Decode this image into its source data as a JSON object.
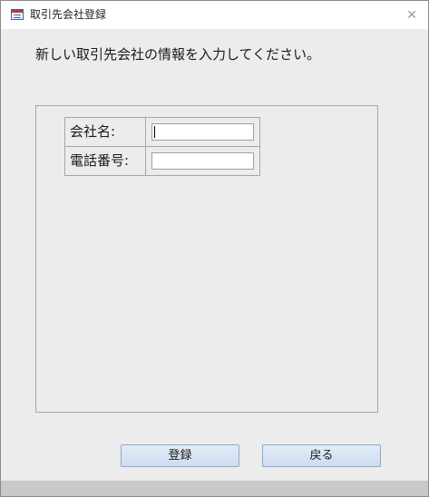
{
  "window": {
    "title": "取引先会社登録",
    "close_icon": "close-icon"
  },
  "instruction": "新しい取引先会社の情報を入力してください。",
  "form": {
    "company_label": "会社名:",
    "company_value": "",
    "phone_label": "電話番号:",
    "phone_value": ""
  },
  "buttons": {
    "register_label": "登録",
    "back_label": "戻る"
  },
  "colors": {
    "background": "#ececec",
    "button_border": "#8fa8c8",
    "icon_accent": "#c0392b"
  }
}
